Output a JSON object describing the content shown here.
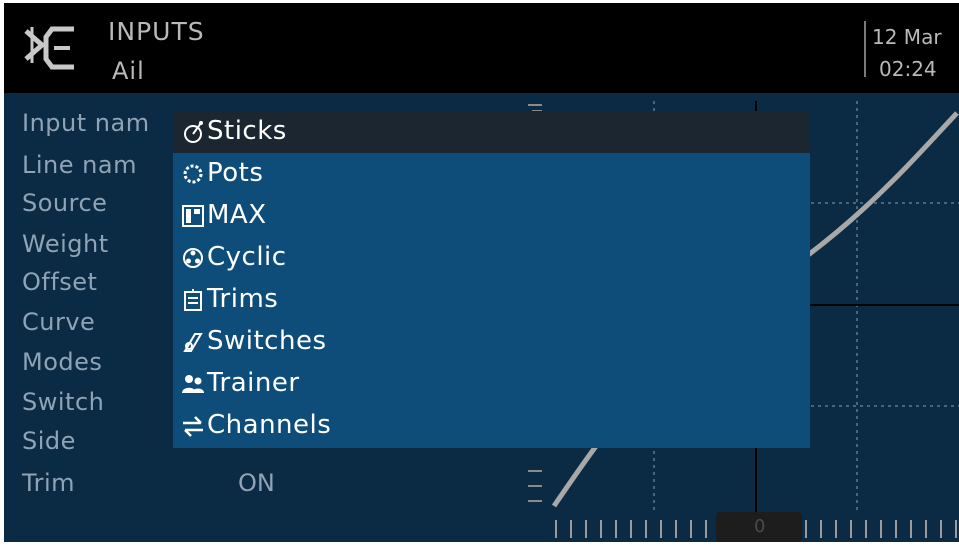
{
  "header": {
    "title": "INPUTS",
    "subtitle": "Ail",
    "date": "12 Mar",
    "time": "02:24"
  },
  "form": {
    "labels": [
      "Input nam",
      "Line nam",
      "Source",
      "Weight",
      "Offset",
      "Curve",
      "Modes",
      "Switch",
      "Side",
      "Trim"
    ],
    "trim_value": "ON"
  },
  "graph": {
    "marker_value": "0"
  },
  "source_menu": {
    "selected_index": 0,
    "items": [
      {
        "label": "Sticks",
        "icon": "stick-icon"
      },
      {
        "label": "Pots",
        "icon": "pot-icon"
      },
      {
        "label": "MAX",
        "icon": "max-icon"
      },
      {
        "label": "Cyclic",
        "icon": "cyclic-icon"
      },
      {
        "label": "Trims",
        "icon": "trim-icon"
      },
      {
        "label": "Switches",
        "icon": "switch-icon"
      },
      {
        "label": "Trainer",
        "icon": "trainer-icon"
      },
      {
        "label": "Channels",
        "icon": "channels-icon"
      }
    ]
  },
  "colors": {
    "screen_bg": "#0b2b44",
    "header_bg": "#000000",
    "menu_bg": "#0e4d7a",
    "menu_selected_bg": "#1b2631",
    "label_text": "#8ea3b6",
    "header_text": "#b9b9b9"
  }
}
